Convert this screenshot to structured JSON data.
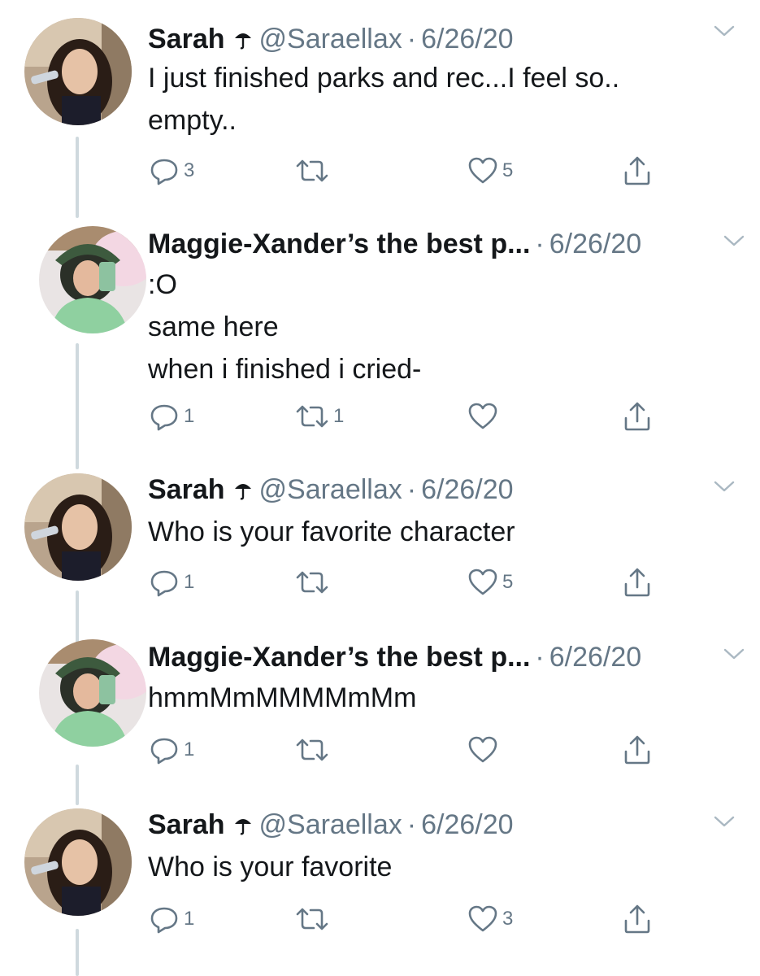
{
  "tweets": [
    {
      "name": "Sarah",
      "handle": "@Saraellax",
      "dot": "·",
      "date": "6/26/20",
      "lines": [
        "I just finished parks and rec...I feel so..",
        "empty.."
      ],
      "replies": "3",
      "retweets": "",
      "likes": "5"
    },
    {
      "name": "Maggie-Xander’s the best p...",
      "handle": "",
      "dot": "·",
      "date": "6/26/20",
      "lines": [
        ":O",
        "same here",
        "when i finished i cried-"
      ],
      "replies": "1",
      "retweets": "1",
      "likes": ""
    },
    {
      "name": "Sarah",
      "handle": "@Saraellax",
      "dot": "·",
      "date": "6/26/20",
      "lines": [
        "Who is your favorite character"
      ],
      "replies": "1",
      "retweets": "",
      "likes": "5"
    },
    {
      "name": "Maggie-Xander’s the best p...",
      "handle": "",
      "dot": "·",
      "date": "6/26/20",
      "lines": [
        "hmmMmMMMMmMm"
      ],
      "replies": "1",
      "retweets": "",
      "likes": ""
    },
    {
      "name": "Sarah",
      "handle": "@Saraellax",
      "dot": "·",
      "date": "6/26/20",
      "lines": [
        "Who is your favorite"
      ],
      "replies": "1",
      "retweets": "",
      "likes": "3"
    }
  ],
  "icons": {
    "reply": "reply-icon",
    "retweet": "retweet-icon",
    "like": "heart-icon",
    "share": "share-icon",
    "caret": "chevron-down-icon",
    "badge": "umbrella-icon"
  },
  "colors": {
    "text": "#14171a",
    "secondary": "#657786",
    "thread_line": "#cfd9de"
  }
}
